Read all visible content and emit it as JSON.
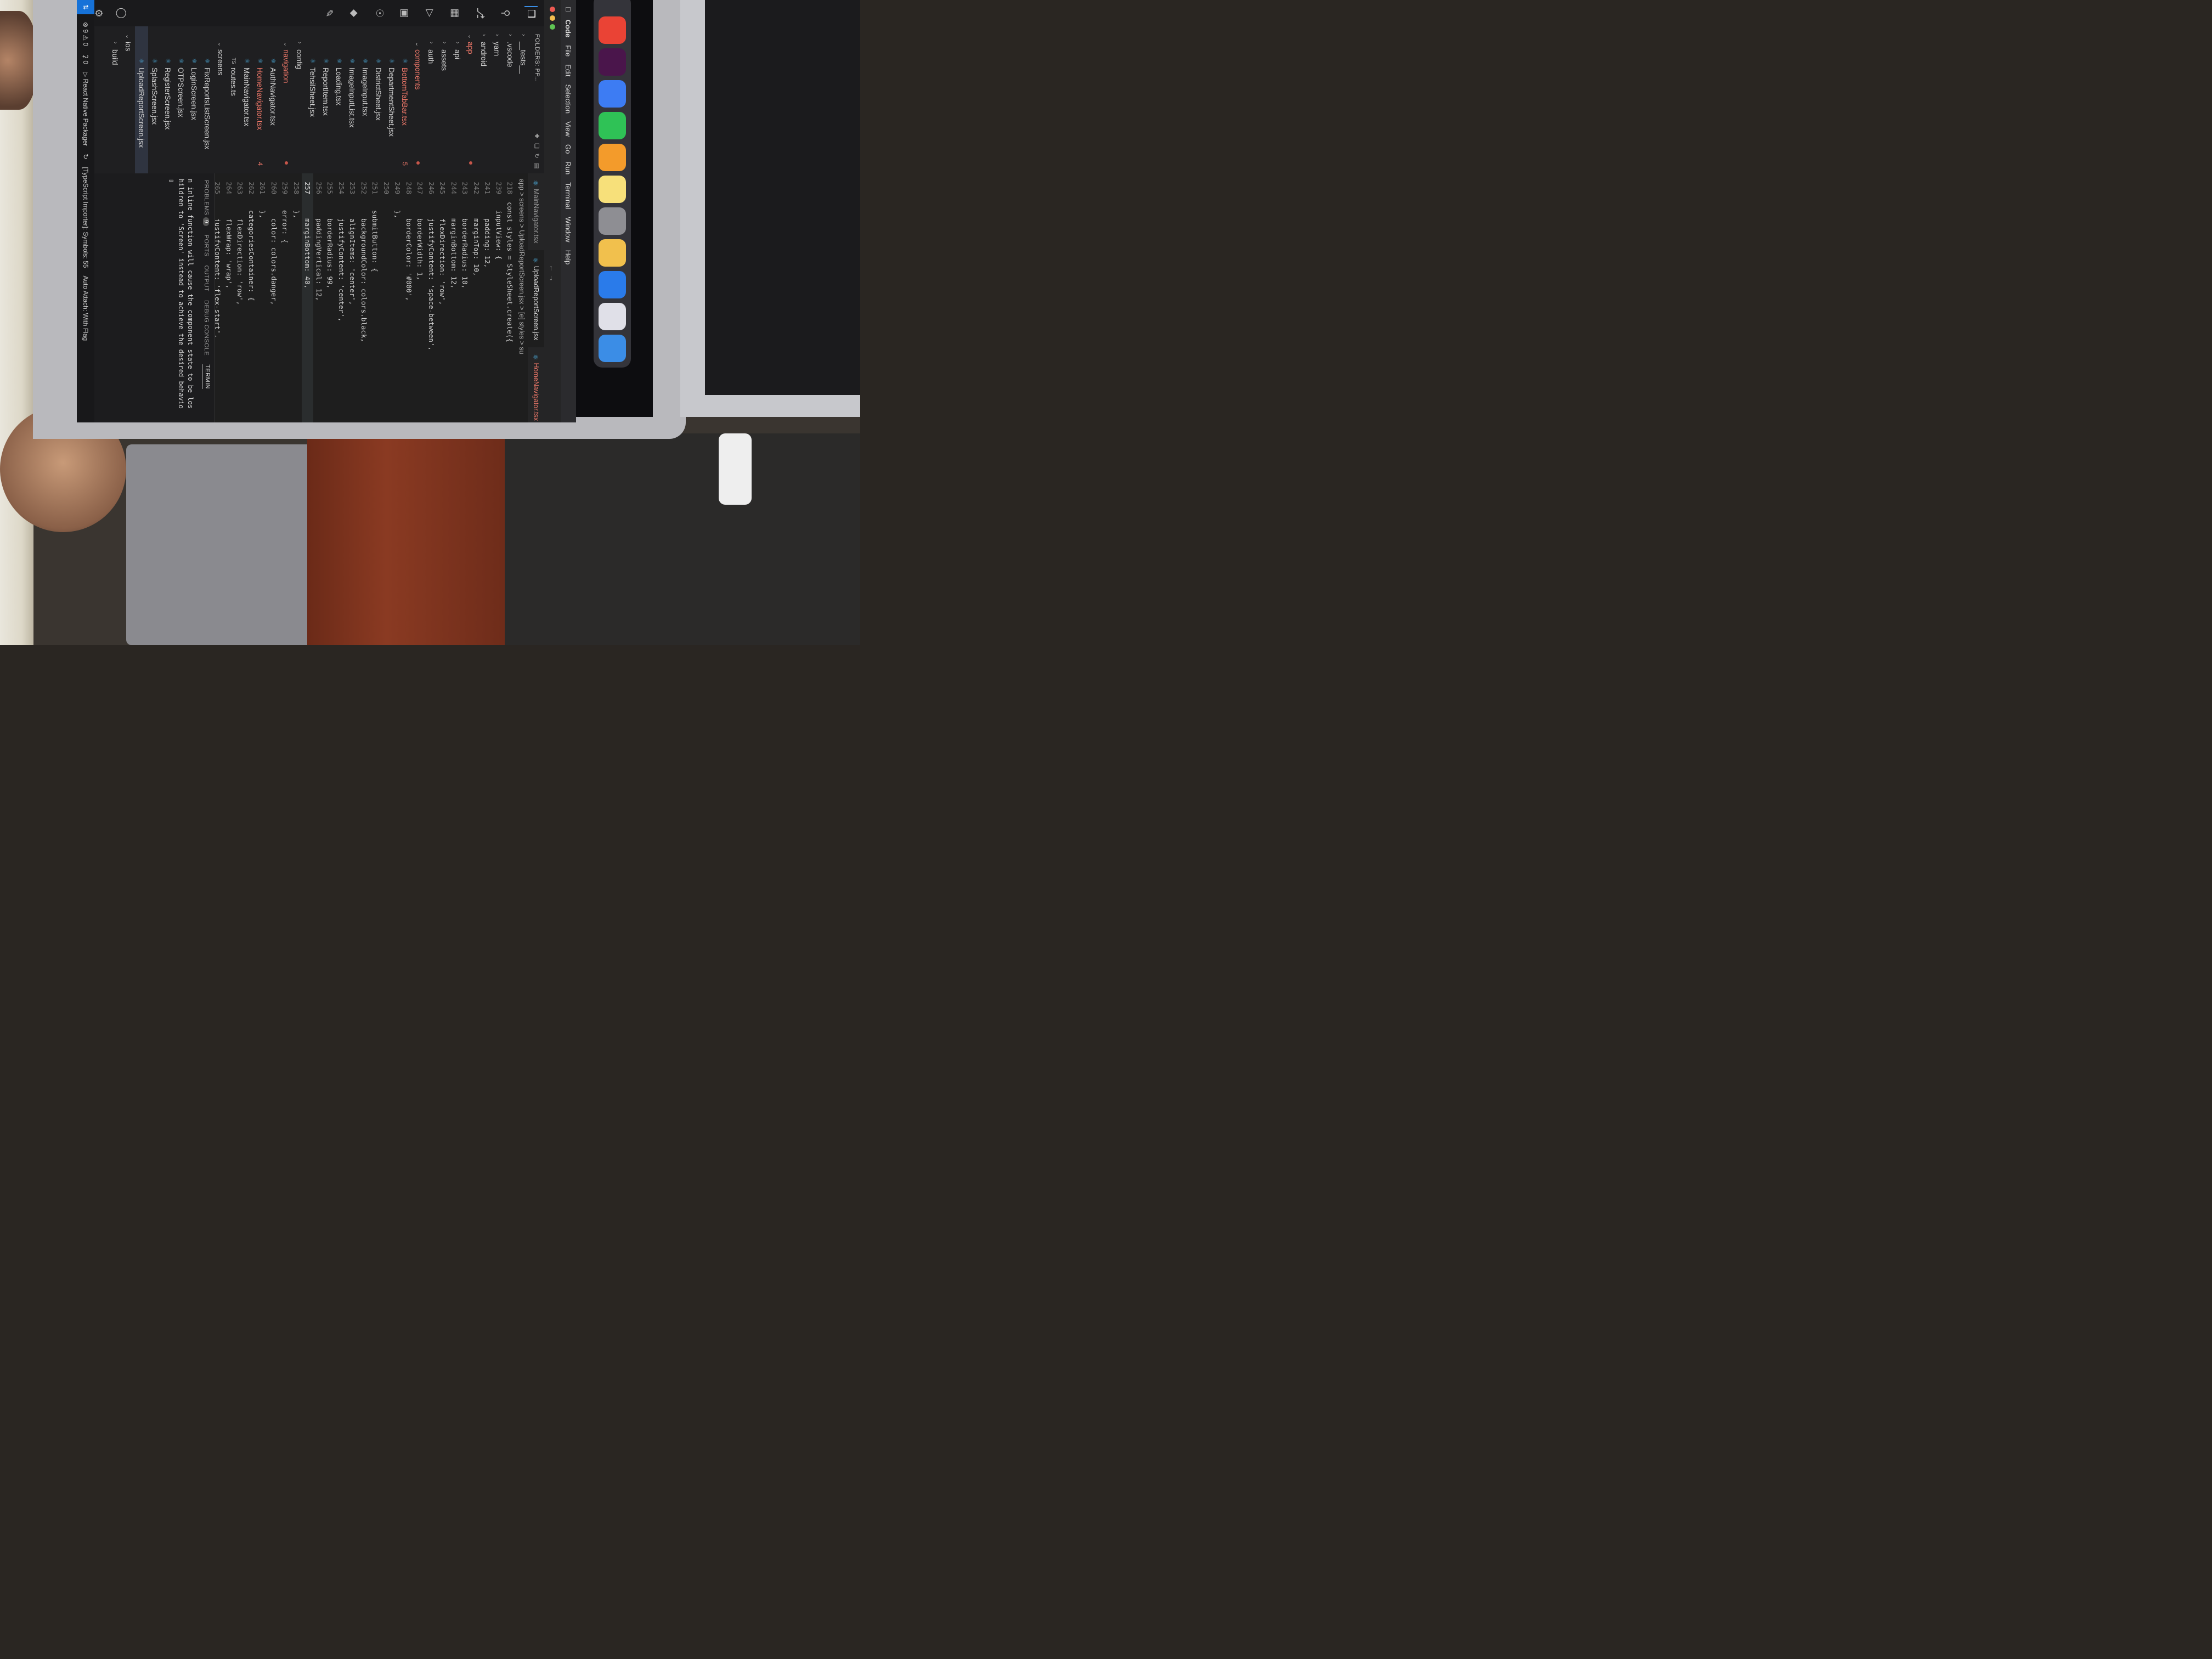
{
  "menubar": {
    "app": "Code",
    "items": [
      "File",
      "Edit",
      "Selection",
      "View",
      "Go",
      "Run",
      "Terminal",
      "Window",
      "Help"
    ]
  },
  "explorer": {
    "title": "FOLDERS: PP...",
    "tree": [
      {
        "label": "__tests__",
        "type": "folder",
        "open": false,
        "depth": 0
      },
      {
        "label": ".vscode",
        "type": "folder",
        "open": false,
        "depth": 0
      },
      {
        "label": "yarn",
        "type": "folder",
        "open": false,
        "depth": 0
      },
      {
        "label": "android",
        "type": "folder",
        "open": false,
        "depth": 0
      },
      {
        "label": "app",
        "type": "folder",
        "open": true,
        "depth": 0,
        "error": true,
        "dot": true
      },
      {
        "label": "api",
        "type": "folder",
        "open": false,
        "depth": 1
      },
      {
        "label": "assets",
        "type": "folder",
        "open": false,
        "depth": 1
      },
      {
        "label": "auth",
        "type": "folder",
        "open": false,
        "depth": 1
      },
      {
        "label": "components",
        "type": "folder",
        "open": true,
        "depth": 1,
        "error": true,
        "dot": true
      },
      {
        "label": "BottomTabBar.tsx",
        "type": "file",
        "depth": 2,
        "error": true,
        "badge": "5"
      },
      {
        "label": "DepartmentSheet.jsx",
        "type": "file",
        "depth": 2
      },
      {
        "label": "DistrictSheet.jsx",
        "type": "file",
        "depth": 2
      },
      {
        "label": "ImageInput.tsx",
        "type": "file",
        "depth": 2
      },
      {
        "label": "ImageInputList.tsx",
        "type": "file",
        "depth": 2
      },
      {
        "label": "Loading.tsx",
        "type": "file",
        "depth": 2
      },
      {
        "label": "ReportItem.tsx",
        "type": "file",
        "depth": 2
      },
      {
        "label": "TehsilSheet.jsx",
        "type": "file",
        "depth": 2
      },
      {
        "label": "config",
        "type": "folder",
        "open": false,
        "depth": 1
      },
      {
        "label": "navigation",
        "type": "folder",
        "open": true,
        "depth": 1,
        "error": true,
        "dot": true
      },
      {
        "label": "AuthNavigator.tsx",
        "type": "file",
        "depth": 2
      },
      {
        "label": "HomeNavigator.tsx",
        "type": "file",
        "depth": 2,
        "error": true,
        "badge": "4"
      },
      {
        "label": "MainNavigator.tsx",
        "type": "file",
        "depth": 2
      },
      {
        "label": "routes.ts",
        "type": "ts",
        "depth": 2
      },
      {
        "label": "screens",
        "type": "folder",
        "open": true,
        "depth": 1
      },
      {
        "label": "FixReportsListScreen.jsx",
        "type": "file",
        "depth": 2
      },
      {
        "label": "LoginScreen.jsx",
        "type": "file",
        "depth": 2
      },
      {
        "label": "OTPScreen.jsx",
        "type": "file",
        "depth": 2
      },
      {
        "label": "RegisterScreen.jsx",
        "type": "file",
        "depth": 2
      },
      {
        "label": "SplashScreen.jsx",
        "type": "file",
        "depth": 2
      },
      {
        "label": "UploadReportScreen.jsx",
        "type": "file",
        "depth": 2,
        "selected": true
      },
      {
        "label": "ios",
        "type": "folder",
        "open": true,
        "depth": 0
      },
      {
        "label": "build",
        "type": "folder",
        "open": false,
        "depth": 1
      }
    ]
  },
  "tabs": [
    {
      "label": "MainNavigator.tsx",
      "active": false,
      "error": false
    },
    {
      "label": "UploadReportScreen.jsx",
      "active": true,
      "error": false
    },
    {
      "label": "HomeNavigator.tsx 4",
      "active": false,
      "error": true
    },
    {
      "label": "Bo",
      "active": false,
      "error": true
    }
  ],
  "breadcrumb": "app > screens > UploadReportScreen.jsx > [e] styles > su",
  "code": [
    {
      "n": "218",
      "t": "const styles = StyleSheet.create({"
    },
    {
      "n": "239",
      "t": "  inputView: {"
    },
    {
      "n": "241",
      "t": "    padding: 12,"
    },
    {
      "n": "242",
      "t": "    marginTop: 10,"
    },
    {
      "n": "243",
      "t": "    borderRadius: 10,"
    },
    {
      "n": "244",
      "t": "    marginBottom: 12,"
    },
    {
      "n": "245",
      "t": "    flexDirection: 'row',"
    },
    {
      "n": "246",
      "t": "    justifyContent: 'space-between',"
    },
    {
      "n": "247",
      "t": "    borderWidth: 1,"
    },
    {
      "n": "248",
      "t": "    borderColor: '#000',"
    },
    {
      "n": "249",
      "t": "  },"
    },
    {
      "n": "250",
      "t": ""
    },
    {
      "n": "251",
      "t": "  submitButton: {"
    },
    {
      "n": "252",
      "t": "    backgroundColor: colors.black,"
    },
    {
      "n": "253",
      "t": "    alignItems: 'center',"
    },
    {
      "n": "254",
      "t": "    justifyContent: 'center',"
    },
    {
      "n": "255",
      "t": "    borderRadius: 99,"
    },
    {
      "n": "256",
      "t": "    paddingVertical: 12,"
    },
    {
      "n": "257",
      "t": "    marginBottom: 40,",
      "current": true
    },
    {
      "n": "258",
      "t": "  },"
    },
    {
      "n": "259",
      "t": "  error: {"
    },
    {
      "n": "260",
      "t": "    color: colors.danger,"
    },
    {
      "n": "261",
      "t": "  },"
    },
    {
      "n": "262",
      "t": "  categoriesContainer: {"
    },
    {
      "n": "263",
      "t": "    flexDirection: 'row',"
    },
    {
      "n": "264",
      "t": "    flexWrap: 'wrap',"
    },
    {
      "n": "265",
      "t": "    justifyContent: 'flex-start',"
    },
    {
      "n": "266",
      "t": "  },"
    },
    {
      "n": "267",
      "t": "  sectionTitle: {flexDirection: 'row', alignItems"
    },
    {
      "n": "268",
      "t": "  categoryPill: {"
    },
    {
      "n": "269",
      "t": "    paddingHorizontal: 8,"
    },
    {
      "n": "270",
      "t": "    paddingVertical: 4,"
    },
    {
      "n": "271",
      "t": "    borderRadius: 100,"
    }
  ],
  "panel": {
    "tabs": [
      "PROBLEMS",
      "PORTS",
      "OUTPUT",
      "DEBUG CONSOLE",
      "TERMIN"
    ],
    "problems_count": "9",
    "terminal_lines": [
      "n inline function will cause the component state to be los",
      "hildren to 'Screen' instead to achieve the desired behavio"
    ]
  },
  "statusbar": {
    "errors": "9",
    "warnings": "0",
    "ports": "0",
    "packager": "React Native Packager",
    "importer": "[TypeScript Importer]: Symbols: 55",
    "auto_attach": "Auto Attach: With Flag"
  },
  "dock": [
    "Finder",
    "Launchpad",
    "App Store",
    "Photos",
    "System Settings",
    "Notes",
    "Pages",
    "WhatsApp",
    "Xcode",
    "Slack",
    "Chrome"
  ],
  "colors": {
    "accent": "#1672d8",
    "error": "#f37a6b",
    "file_icon": "#4fb6e8"
  }
}
